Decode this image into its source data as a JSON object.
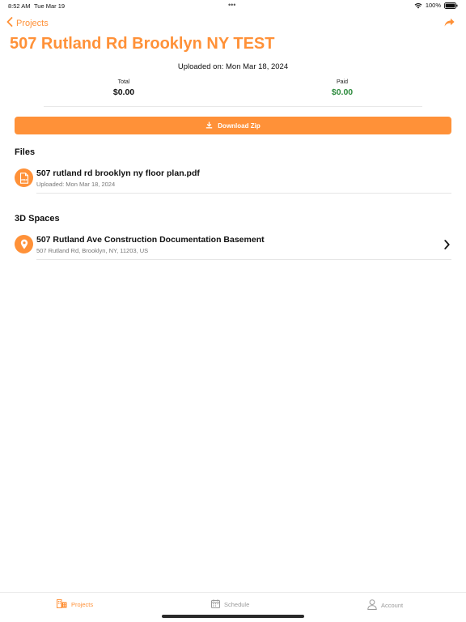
{
  "status_bar": {
    "time": "8:52 AM",
    "date": "Tue Mar 19",
    "dots": "•••",
    "battery_pct": "100%",
    "battery_level": 1.0
  },
  "nav": {
    "back_label": "Projects",
    "back_icon": "chevron-left-icon",
    "share_icon": "share-arrow-icon"
  },
  "project": {
    "title": "507 Rutland Rd Brooklyn NY TEST",
    "uploaded_on": "Uploaded on: Mon Mar 18, 2024"
  },
  "totals": {
    "total_label": "Total",
    "total_value": "$0.00",
    "paid_label": "Paid",
    "paid_value": "$0.00"
  },
  "download": {
    "label": "Download Zip",
    "icon": "download-icon"
  },
  "files": {
    "title": "Files",
    "items": [
      {
        "name": "507 rutland rd brooklyn ny floor plan.pdf",
        "subtitle": "Uploaded: Mon Mar 18, 2024",
        "icon": "pdf-file-icon"
      }
    ]
  },
  "spaces": {
    "title": "3D Spaces",
    "items": [
      {
        "name": "507 Rutland Ave Construction Documentation Basement",
        "subtitle": "507 Rutland Rd, Brooklyn, NY, 11203, US",
        "icon": "location-pin-icon"
      }
    ]
  },
  "tabs": [
    {
      "label": "Projects",
      "icon": "projects-icon",
      "active": true
    },
    {
      "label": "Schedule",
      "icon": "calendar-icon",
      "active": false
    },
    {
      "label": "Account",
      "icon": "person-icon",
      "active": false
    }
  ],
  "colors": {
    "accent": "#FF9138",
    "paid_green": "#2E8B3E",
    "inactive_tab": "#9A9A9A"
  }
}
